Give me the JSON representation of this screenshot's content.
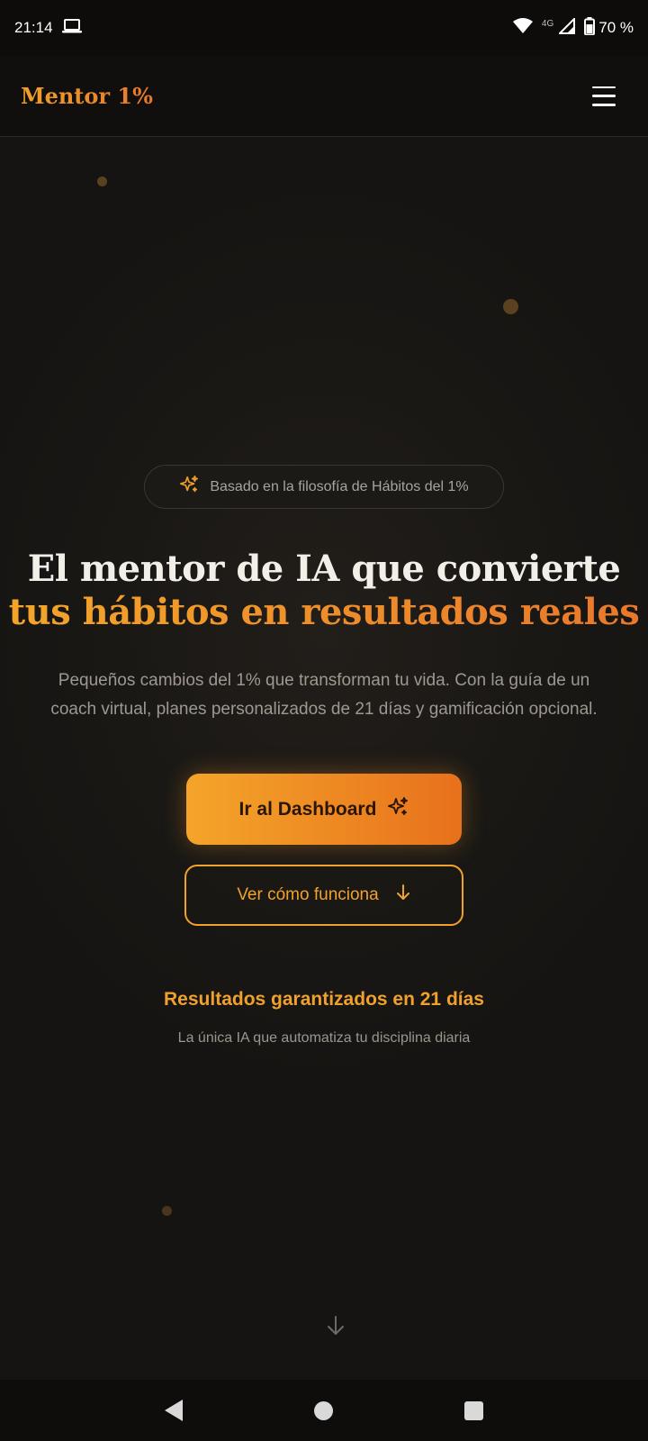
{
  "status_bar": {
    "time": "21:14",
    "network": "4G",
    "battery": "70 %"
  },
  "header": {
    "logo": "Mentor 1%"
  },
  "hero": {
    "badge": "Basado en la filosofía de Hábitos del 1%",
    "title_line1": "El mentor de IA que convierte",
    "title_line2": "tus hábitos en resultados reales",
    "subtitle_line1": "Pequeños cambios del 1% que transforman tu vida. Con la guía de un",
    "subtitle_line2": "coach virtual, planes personalizados de 21 días y gamificación opcional.",
    "primary_button": "Ir al Dashboard",
    "secondary_button": "Ver cómo funciona",
    "results_title": "Resultados garantizados en 21 días",
    "results_subtitle": "La única IA que automatiza tu disciplina diaria"
  },
  "colors": {
    "accent": "#f0a02a",
    "accent_end": "#e8711c",
    "background": "#171513"
  },
  "icons": {
    "laptop": "laptop-icon",
    "wifi": "wifi-icon",
    "signal": "signal-icon",
    "battery": "battery-icon",
    "menu": "hamburger-menu-icon",
    "sparkles": "sparkles-icon",
    "arrow_down": "arrow-down-icon"
  }
}
